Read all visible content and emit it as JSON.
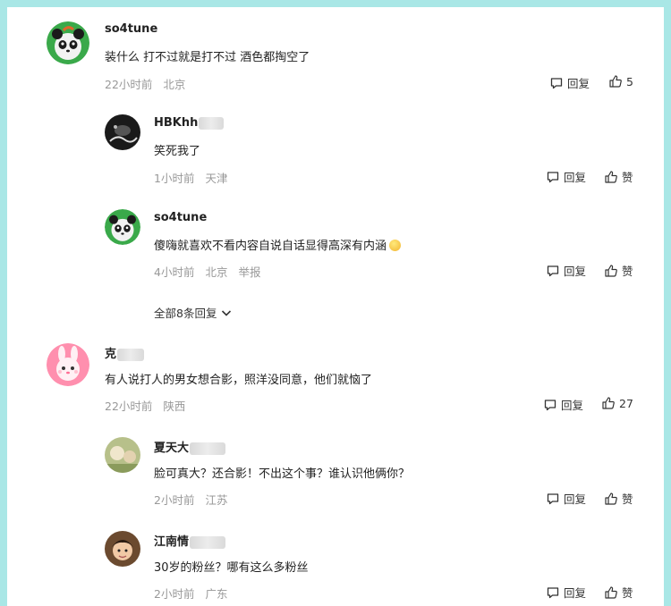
{
  "comments": [
    {
      "author": "so4tune",
      "text": "装什么 打不过就是打不过 酒色都掏空了",
      "time": "22小时前",
      "location": "北京",
      "reply_label": "回复",
      "likes": "5",
      "avatar_icon": "panda-avatar-icon",
      "replies": [
        {
          "author": "HBKhh",
          "text": "笑死我了",
          "time": "1小时前",
          "location": "天津",
          "reply_label": "回复",
          "like_label": "赞",
          "avatar_icon": "dark-photo-avatar"
        },
        {
          "author": "so4tune",
          "text": "傻嗨就喜欢不看内容自说自话显得高深有内涵",
          "time": "4小时前",
          "location": "北京",
          "report_label": "举报",
          "reply_label": "回复",
          "like_label": "赞",
          "avatar_icon": "panda-avatar-icon"
        }
      ],
      "more_replies_label": "全部8条回复"
    },
    {
      "author": "克",
      "text": "有人说打人的男女想合影，照洋没同意，他们就恼了",
      "time": "22小时前",
      "location": "陕西",
      "reply_label": "回复",
      "likes": "27",
      "avatar_icon": "pink-bunny-avatar-icon",
      "replies": [
        {
          "author": "夏天大",
          "text": "脸可真大？还合影！不出这个事？谁认识他俩你？",
          "time": "2小时前",
          "location": "江苏",
          "reply_label": "回复",
          "like_label": "赞",
          "avatar_icon": "photo-avatar"
        },
        {
          "author": "江南情",
          "text": "30岁的粉丝？哪有这么多粉丝",
          "time": "2小时前",
          "location": "广东",
          "reply_label": "回复",
          "like_label": "赞",
          "avatar_icon": "person-avatar"
        }
      ]
    }
  ],
  "colors": {
    "background": "#a9e7e6",
    "panel": "#ffffff",
    "meta_text": "#999999",
    "main_text": "#222222"
  }
}
